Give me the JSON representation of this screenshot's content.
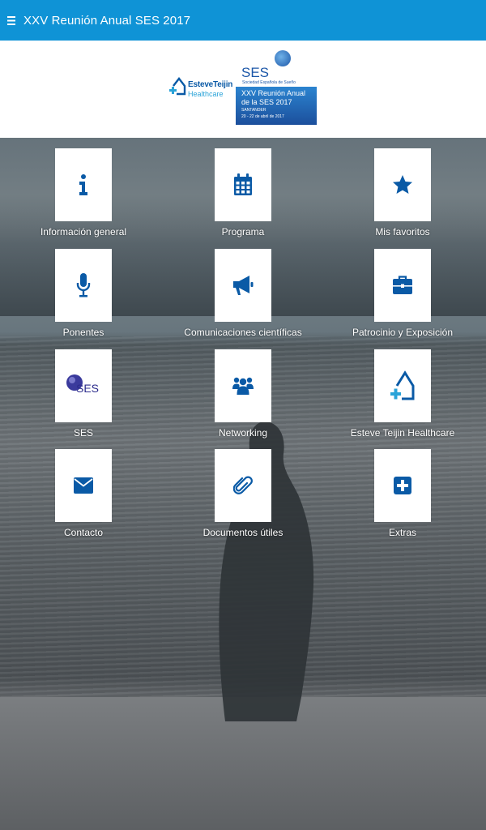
{
  "app_bar": {
    "title": "XXV Reunión Anual SES 2017",
    "menu_icon": "hamburger-menu-icon"
  },
  "banner": {
    "sponsor_logo": {
      "brand_bold": "EsteveTeijin",
      "brand_light": "Healthcare"
    },
    "event_logo": {
      "acronym": "SES",
      "society": "Sociedad Española de Sueño",
      "event_line1": "XXV Reunión Anual",
      "event_line2": "de la SES 2017",
      "city": "SANTANDER",
      "dates": "20 - 22 de abril de 2017"
    }
  },
  "menu": [
    {
      "label": "Información general",
      "icon": "info-icon"
    },
    {
      "label": "Programa",
      "icon": "calendar-icon"
    },
    {
      "label": "Mis favoritos",
      "icon": "star-icon"
    },
    {
      "label": "Ponentes",
      "icon": "microphone-icon"
    },
    {
      "label": "Comunicaciones científicas",
      "icon": "megaphone-icon"
    },
    {
      "label": "Patrocinio y Exposición",
      "icon": "briefcase-icon"
    },
    {
      "label": "SES",
      "icon": "ses-logo-icon",
      "logo_text": "SES"
    },
    {
      "label": "Networking",
      "icon": "users-icon"
    },
    {
      "label": "Esteve Teijin Healthcare",
      "icon": "esteve-house-icon"
    },
    {
      "label": "Contacto",
      "icon": "envelope-icon"
    },
    {
      "label": "Documentos útiles",
      "icon": "paperclip-icon"
    },
    {
      "label": "Extras",
      "icon": "plus-square-icon"
    }
  ],
  "colors": {
    "app_bar": "#0f93d6",
    "icon_blue": "#0a5aa6",
    "accent_cyan": "#2aa3d8"
  }
}
